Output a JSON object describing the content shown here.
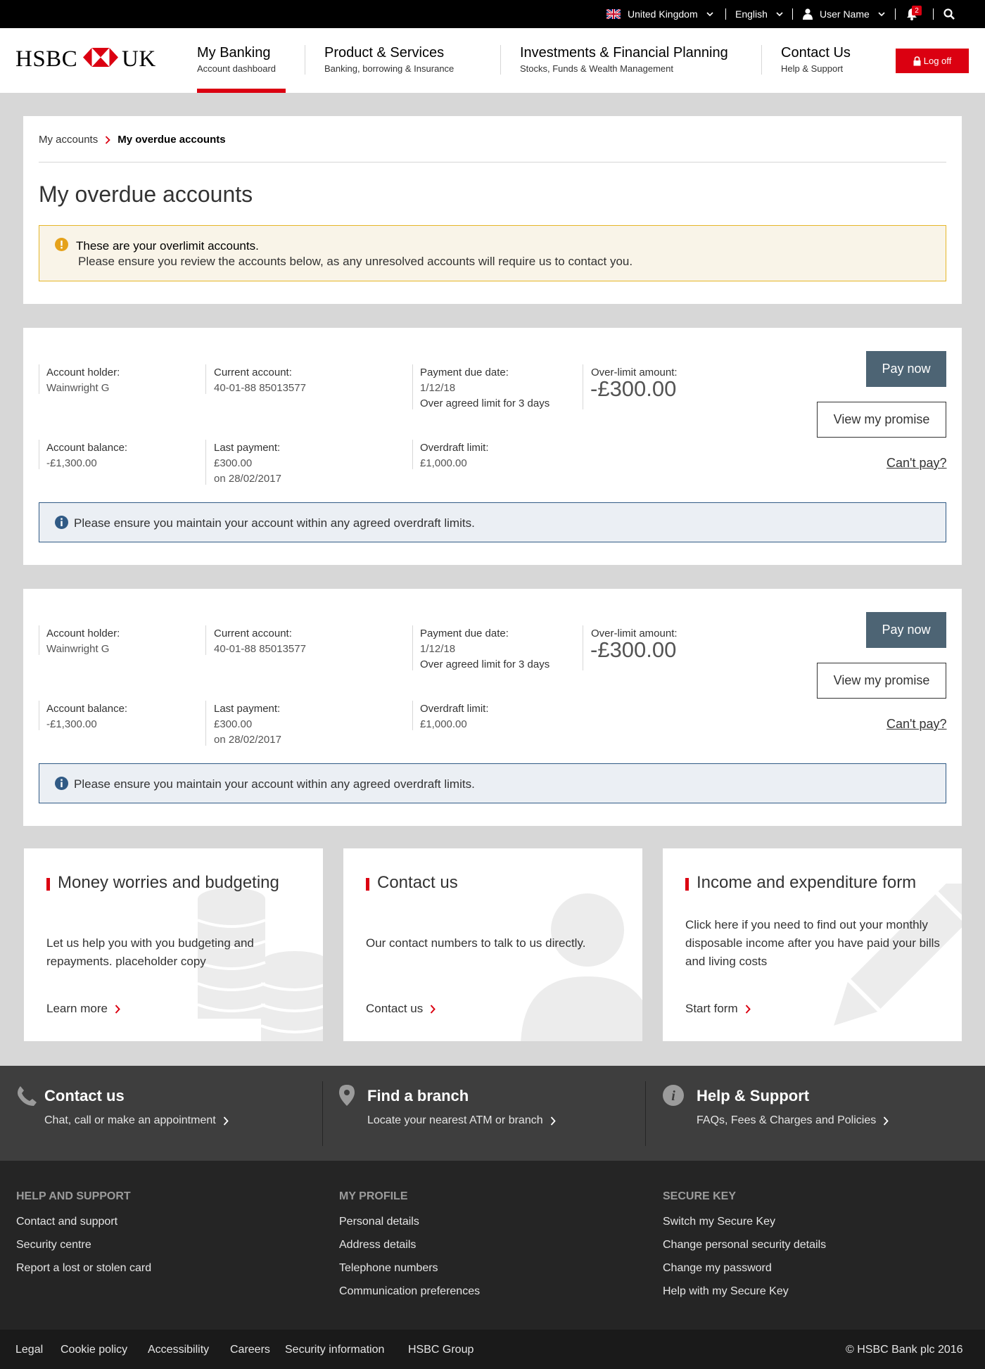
{
  "topbar": {
    "country": "United Kingdom",
    "language": "English",
    "user": "User Name",
    "notification_count": "2"
  },
  "header": {
    "logo_left": "HSBC",
    "logo_right": "UK",
    "nav": [
      {
        "title": "My Banking",
        "sub": "Account dashboard"
      },
      {
        "title": "Product & Services",
        "sub": "Banking, borrowing & Insurance"
      },
      {
        "title": "Investments & Financial Planning",
        "sub": "Stocks, Funds & Wealth Management"
      },
      {
        "title": "Contact Us",
        "sub": "Help & Support"
      }
    ],
    "logoff": "Log off"
  },
  "breadcrumb": {
    "parent": "My accounts",
    "current": "My overdue accounts"
  },
  "page_title": "My overdue accounts",
  "alert": {
    "title": "These are your overlimit accounts.",
    "text": "Please ensure you review the accounts below, as any unresolved accounts will require us to contact you."
  },
  "labels": {
    "holder": "Account holder:",
    "current": "Current account:",
    "due": "Payment due date:",
    "overlimit": "Over-limit amount:",
    "balance": "Account balance:",
    "last_payment": "Last payment:",
    "overdraft": "Overdraft limit:",
    "pay_now": "Pay now",
    "view_promise": "View my promise",
    "cant_pay": "Can't pay?"
  },
  "accounts": [
    {
      "holder": "Wainwright G",
      "account": "40-01-88  85013577",
      "due_date": "1/12/18",
      "over_days": "Over agreed limit for 3 days",
      "overlimit_amount": "-£300.00",
      "balance": "-£1,300.00",
      "last_payment_amount": "£300.00",
      "last_payment_date": "on 28/02/2017",
      "overdraft_limit": "£1,000.00",
      "info": "Please ensure you maintain your account within any agreed overdraft limits."
    },
    {
      "holder": "Wainwright G",
      "account": "40-01-88  85013577",
      "due_date": "1/12/18",
      "over_days": "Over agreed limit for 3 days",
      "overlimit_amount": "-£300.00",
      "balance": "-£1,300.00",
      "last_payment_amount": "£300.00",
      "last_payment_date": "on 28/02/2017",
      "overdraft_limit": "£1,000.00",
      "info": "Please ensure you maintain your account within any agreed overdraft limits."
    }
  ],
  "cards": [
    {
      "title": "Money worries and budgeting",
      "text": "Let us help you with you budgeting and repayments. placeholder copy",
      "link": "Learn more",
      "icon": "coins-icon"
    },
    {
      "title": "Contact us",
      "text": "Our contact numbers to talk to us directly.",
      "link": "Contact us",
      "icon": "person-icon"
    },
    {
      "title": "Income and expenditure form",
      "text": "Click here if you need to find out your monthly disposable income after you have paid your bills and living costs",
      "link": "Start form",
      "icon": "pencil-icon"
    }
  ],
  "footer_top": [
    {
      "title": "Contact us",
      "link": "Chat, call or make an appointment",
      "icon": "phone-icon"
    },
    {
      "title": "Find a branch",
      "link": "Locate your nearest ATM or branch",
      "icon": "location-pin-icon"
    },
    {
      "title": "Help & Support",
      "link": "FAQs, Fees & Charges and Policies",
      "icon": "info-icon"
    }
  ],
  "footer_columns": [
    {
      "heading": "HELP AND SUPPORT",
      "links": [
        "Contact and support",
        "Security centre",
        "Report a lost or stolen card"
      ]
    },
    {
      "heading": "MY PROFILE",
      "links": [
        "Personal details",
        "Address details",
        "Telephone numbers",
        "Communication preferences"
      ]
    },
    {
      "heading": "SECURE KEY",
      "links": [
        "Switch my Secure Key",
        "Change personal security details",
        "Change my password",
        "Help with my Secure Key"
      ]
    }
  ],
  "footer_bottom": {
    "links": [
      "Legal",
      "Cookie policy",
      "Accessibility",
      "Careers",
      "Security information",
      "HSBC Group"
    ],
    "copyright": "© HSBC Bank plc 2016"
  },
  "colors": {
    "brand_red": "#db0011",
    "pay_button": "#4d6474",
    "alert_border": "#e5b628",
    "info_border": "#305a85"
  }
}
